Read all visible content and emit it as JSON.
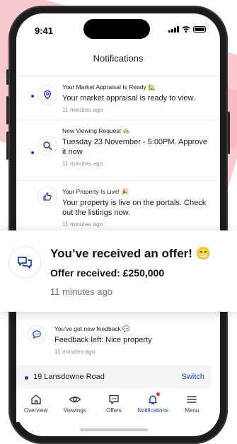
{
  "status": {
    "time": "9:41"
  },
  "header": {
    "title": "Notifications"
  },
  "notifications": [
    {
      "title": "Your Market Appraisal Is Ready 🏡",
      "body": "Your market appraisal is ready to view.",
      "time": "11 minutes ago",
      "icon": "location-pin-icon",
      "unread": true
    },
    {
      "title": "New Viewing Request 🏘️",
      "body": "Tuesday 23 November - 5:00PM. Approve it now",
      "time": "11 minutes ago",
      "icon": "search-icon",
      "unread": true
    },
    {
      "title": "Your Property Is Live! 🎉",
      "body": "Your property is live on the portals. Check out the listings now.",
      "time": "11 minutes ago",
      "icon": "thumbs-up-icon",
      "unread": false
    }
  ],
  "offer_card": {
    "title": "You’ve received an offer! 😁",
    "body": "Offer received: £250,000",
    "time": "11 minutes ago",
    "icon": "chat-bubbles-icon"
  },
  "feedback": {
    "title": "You've got new feedback 💬",
    "body": "Feedback left: Nice property",
    "time": "11 minutes ago",
    "icon": "chat-bubble-icon"
  },
  "address_bar": {
    "address": "19 Lansdowne Road",
    "switch_label": "Switch"
  },
  "tabs": [
    {
      "label": "Overview",
      "icon": "home-icon",
      "active": false
    },
    {
      "label": "Viewings",
      "icon": "eye-icon",
      "active": false
    },
    {
      "label": "Offers",
      "icon": "offers-icon",
      "active": false
    },
    {
      "label": "Notifications",
      "icon": "bell-icon",
      "active": true
    },
    {
      "label": "Menu",
      "icon": "menu-icon",
      "active": false
    }
  ],
  "colors": {
    "accent": "#1b3fb0",
    "badge": "#e5322e",
    "background_blob": "#f8c9cf"
  }
}
